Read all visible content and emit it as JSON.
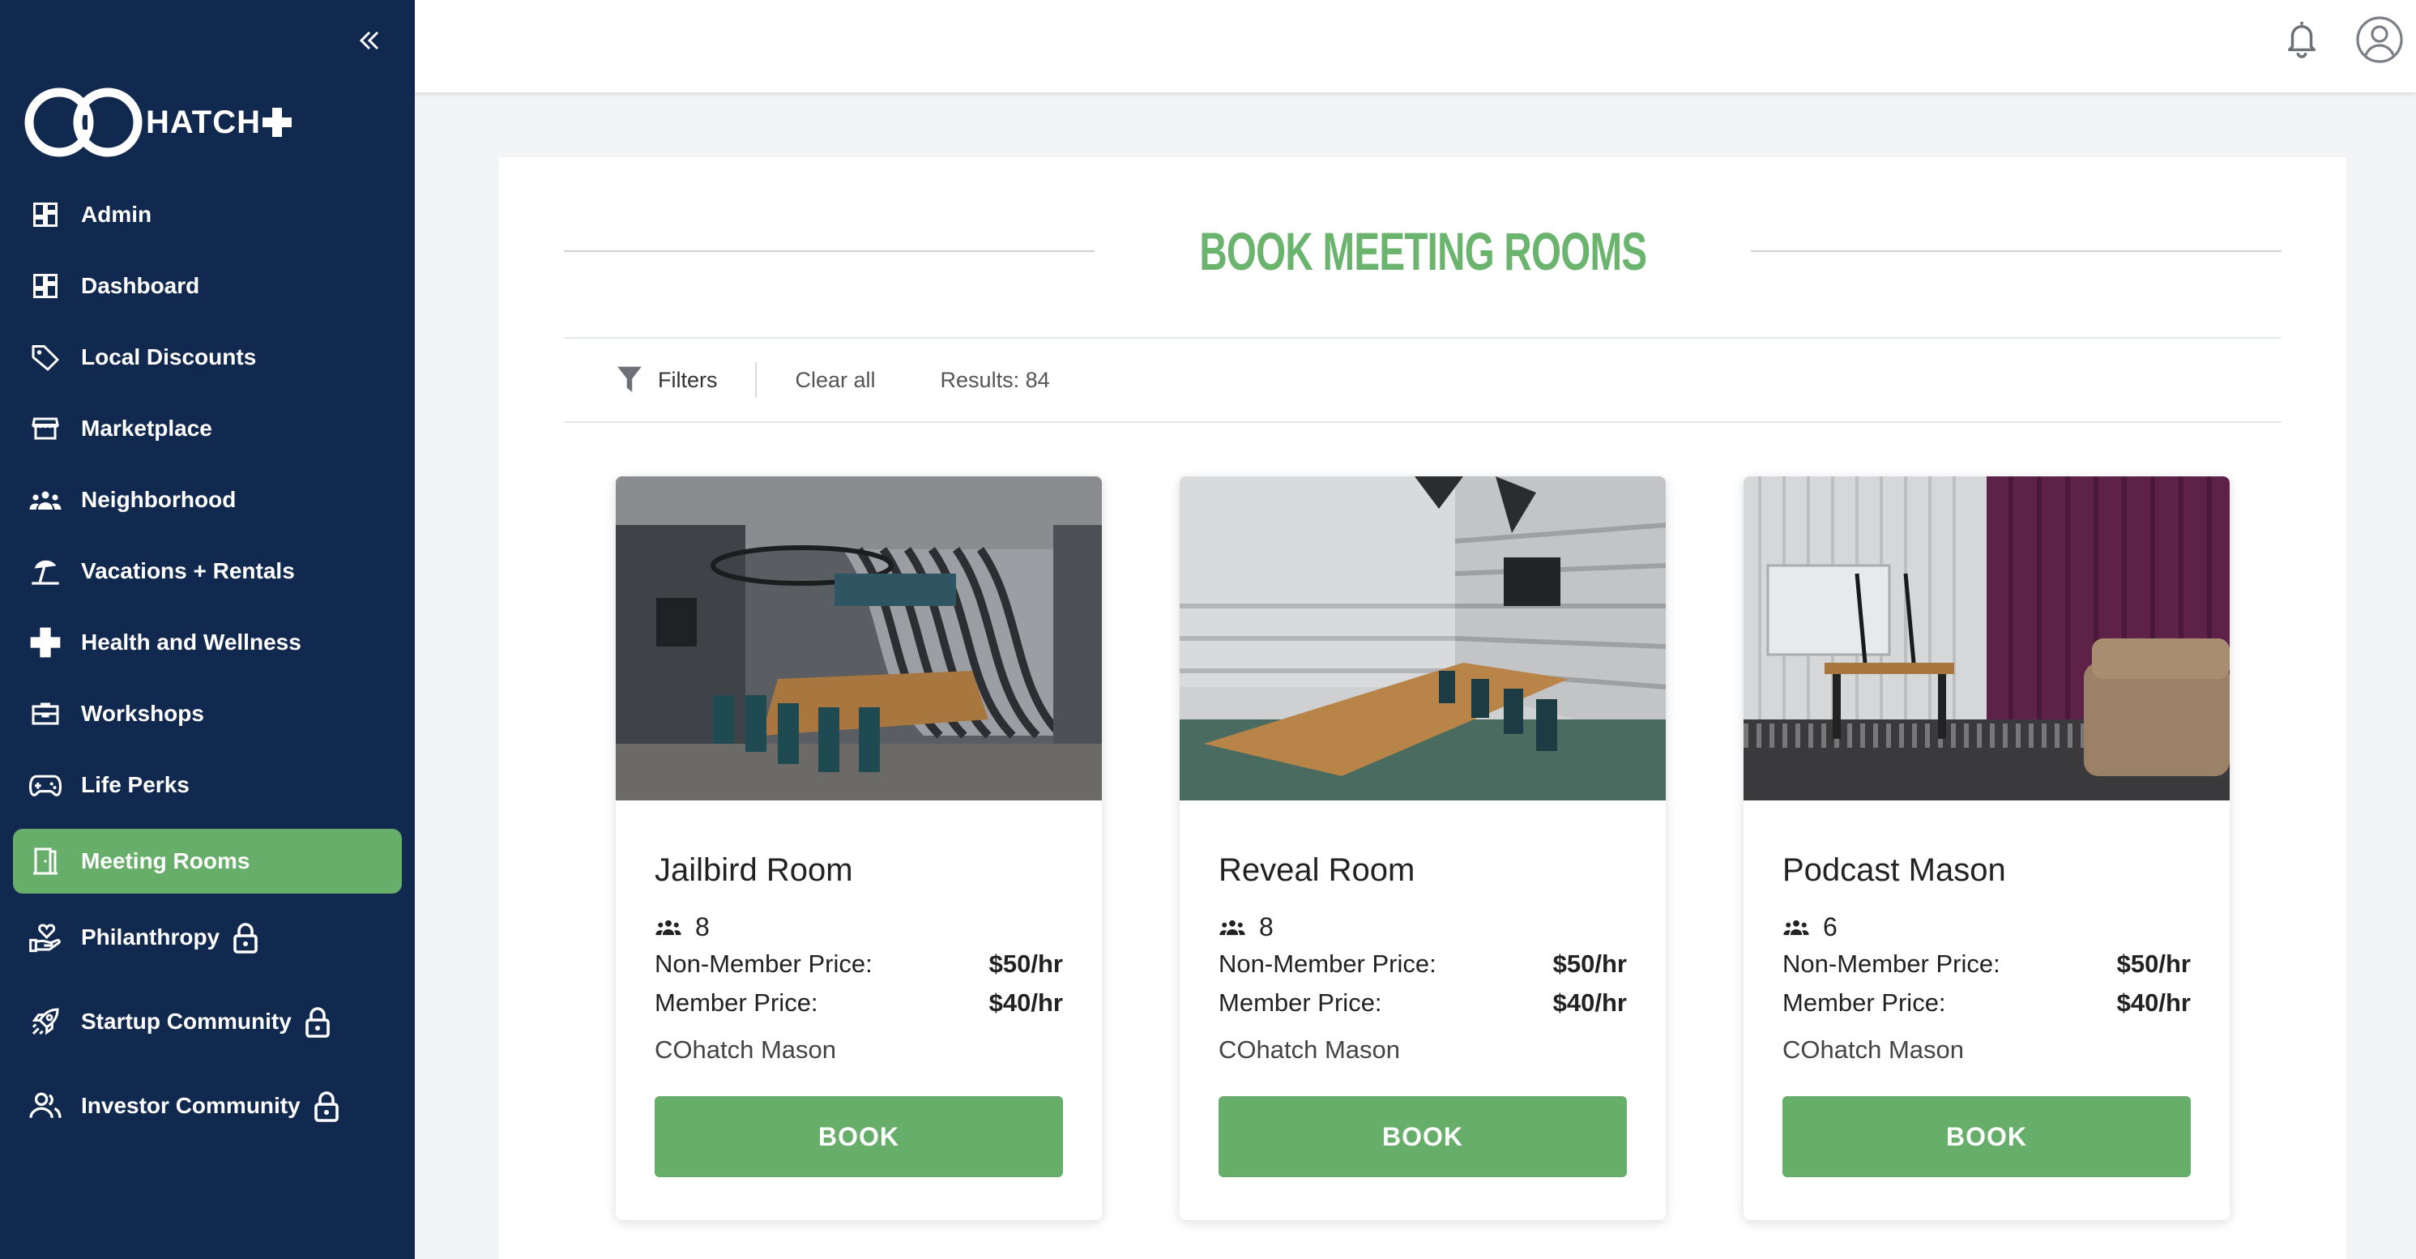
{
  "brand": {
    "logo_text": "HATCH"
  },
  "sidebar": {
    "items": [
      {
        "label": "Admin",
        "icon": "dashboard-grid-icon"
      },
      {
        "label": "Dashboard",
        "icon": "dashboard-grid-icon"
      },
      {
        "label": "Local Discounts",
        "icon": "tag-icon"
      },
      {
        "label": "Marketplace",
        "icon": "storefront-icon"
      },
      {
        "label": "Neighborhood",
        "icon": "people-group-icon"
      },
      {
        "label": "Vacations + Rentals",
        "icon": "beach-umbrella-icon"
      },
      {
        "label": "Health and Wellness",
        "icon": "medical-cross-icon"
      },
      {
        "label": "Workshops",
        "icon": "toolbox-icon"
      },
      {
        "label": "Life Perks",
        "icon": "gamepad-icon"
      },
      {
        "label": "Meeting Rooms",
        "icon": "door-icon",
        "active": true
      },
      {
        "label": "Philanthropy",
        "icon": "hand-heart-icon",
        "locked": true
      },
      {
        "label": "Startup Community",
        "icon": "rocket-icon",
        "locked": true
      },
      {
        "label": "Investor Community",
        "icon": "users-icon",
        "locked": true
      }
    ]
  },
  "main": {
    "title": "BOOK MEETING ROOMS",
    "filters": {
      "label": "Filters",
      "clear_label": "Clear all",
      "results_text": "Results: 84"
    },
    "rooms": [
      {
        "name": "Jailbird Room",
        "capacity": "8",
        "non_member_label": "Non-Member Price:",
        "non_member_price": "$50/hr",
        "member_label": "Member Price:",
        "member_price": "$40/hr",
        "location": "COhatch Mason",
        "book_label": "BOOK"
      },
      {
        "name": "Reveal Room",
        "capacity": "8",
        "non_member_label": "Non-Member Price:",
        "non_member_price": "$50/hr",
        "member_label": "Member Price:",
        "member_price": "$40/hr",
        "location": "COhatch Mason",
        "book_label": "BOOK"
      },
      {
        "name": "Podcast Mason",
        "capacity": "6",
        "non_member_label": "Non-Member Price:",
        "non_member_price": "$50/hr",
        "member_label": "Member Price:",
        "member_price": "$40/hr",
        "location": "COhatch Mason",
        "book_label": "BOOK"
      }
    ]
  },
  "colors": {
    "sidebar_bg": "#12294f",
    "accent_green": "#66ae6a",
    "title_green": "#6ab46e"
  }
}
